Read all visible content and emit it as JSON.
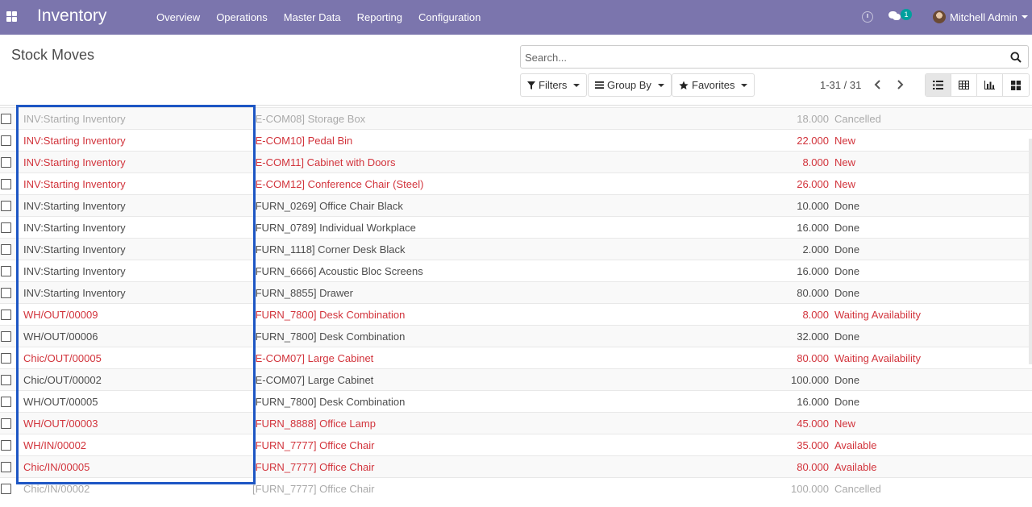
{
  "navbar": {
    "app_title": "Inventory",
    "menu": [
      "Overview",
      "Operations",
      "Master Data",
      "Reporting",
      "Configuration"
    ],
    "chat_badge": "1",
    "user_name": "Mitchell Admin"
  },
  "control_panel": {
    "title": "Stock Moves",
    "search_placeholder": "Search...",
    "filters_label": "Filters",
    "groupby_label": "Group By",
    "favorites_label": "Favorites",
    "pager": "1-31 / 31"
  },
  "colors": {
    "navbar": "#7b75ad",
    "danger": "#d2343c",
    "highlight": "#1d56c4"
  },
  "rows": [
    {
      "reference": "INV:Starting Inventory",
      "product": "[E-COM08] Storage Box",
      "quantity": "18.000",
      "status": "Cancelled",
      "style": "cancelled"
    },
    {
      "reference": "INV:Starting Inventory",
      "product": "[E-COM10] Pedal Bin",
      "quantity": "22.000",
      "status": "New",
      "style": "danger"
    },
    {
      "reference": "INV:Starting Inventory",
      "product": "[E-COM11] Cabinet with Doors",
      "quantity": "8.000",
      "status": "New",
      "style": "danger"
    },
    {
      "reference": "INV:Starting Inventory",
      "product": "[E-COM12] Conference Chair (Steel)",
      "quantity": "26.000",
      "status": "New",
      "style": "danger"
    },
    {
      "reference": "INV:Starting Inventory",
      "product": "[FURN_0269] Office Chair Black",
      "quantity": "10.000",
      "status": "Done",
      "style": "done"
    },
    {
      "reference": "INV:Starting Inventory",
      "product": "[FURN_0789] Individual Workplace",
      "quantity": "16.000",
      "status": "Done",
      "style": "done"
    },
    {
      "reference": "INV:Starting Inventory",
      "product": "[FURN_1118] Corner Desk Black",
      "quantity": "2.000",
      "status": "Done",
      "style": "done"
    },
    {
      "reference": "INV:Starting Inventory",
      "product": "[FURN_6666] Acoustic Bloc Screens",
      "quantity": "16.000",
      "status": "Done",
      "style": "done"
    },
    {
      "reference": "INV:Starting Inventory",
      "product": "[FURN_8855] Drawer",
      "quantity": "80.000",
      "status": "Done",
      "style": "done"
    },
    {
      "reference": "WH/OUT/00009",
      "product": "[FURN_7800] Desk Combination",
      "quantity": "8.000",
      "status": "Waiting Availability",
      "style": "danger"
    },
    {
      "reference": "WH/OUT/00006",
      "product": "[FURN_7800] Desk Combination",
      "quantity": "32.000",
      "status": "Done",
      "style": "done"
    },
    {
      "reference": "Chic/OUT/00005",
      "product": "[E-COM07] Large Cabinet",
      "quantity": "80.000",
      "status": "Waiting Availability",
      "style": "danger"
    },
    {
      "reference": "Chic/OUT/00002",
      "product": "[E-COM07] Large Cabinet",
      "quantity": "100.000",
      "status": "Done",
      "style": "done"
    },
    {
      "reference": "WH/OUT/00005",
      "product": "[FURN_7800] Desk Combination",
      "quantity": "16.000",
      "status": "Done",
      "style": "done"
    },
    {
      "reference": "WH/OUT/00003",
      "product": "[FURN_8888] Office Lamp",
      "quantity": "45.000",
      "status": "New",
      "style": "danger"
    },
    {
      "reference": "WH/IN/00002",
      "product": "[FURN_7777] Office Chair",
      "quantity": "35.000",
      "status": "Available",
      "style": "danger"
    },
    {
      "reference": "Chic/IN/00005",
      "product": "[FURN_7777] Office Chair",
      "quantity": "80.000",
      "status": "Available",
      "style": "danger"
    },
    {
      "reference": "Chic/IN/00002",
      "product": "[FURN_7777] Office Chair",
      "quantity": "100.000",
      "status": "Cancelled",
      "style": "cancelled"
    }
  ]
}
